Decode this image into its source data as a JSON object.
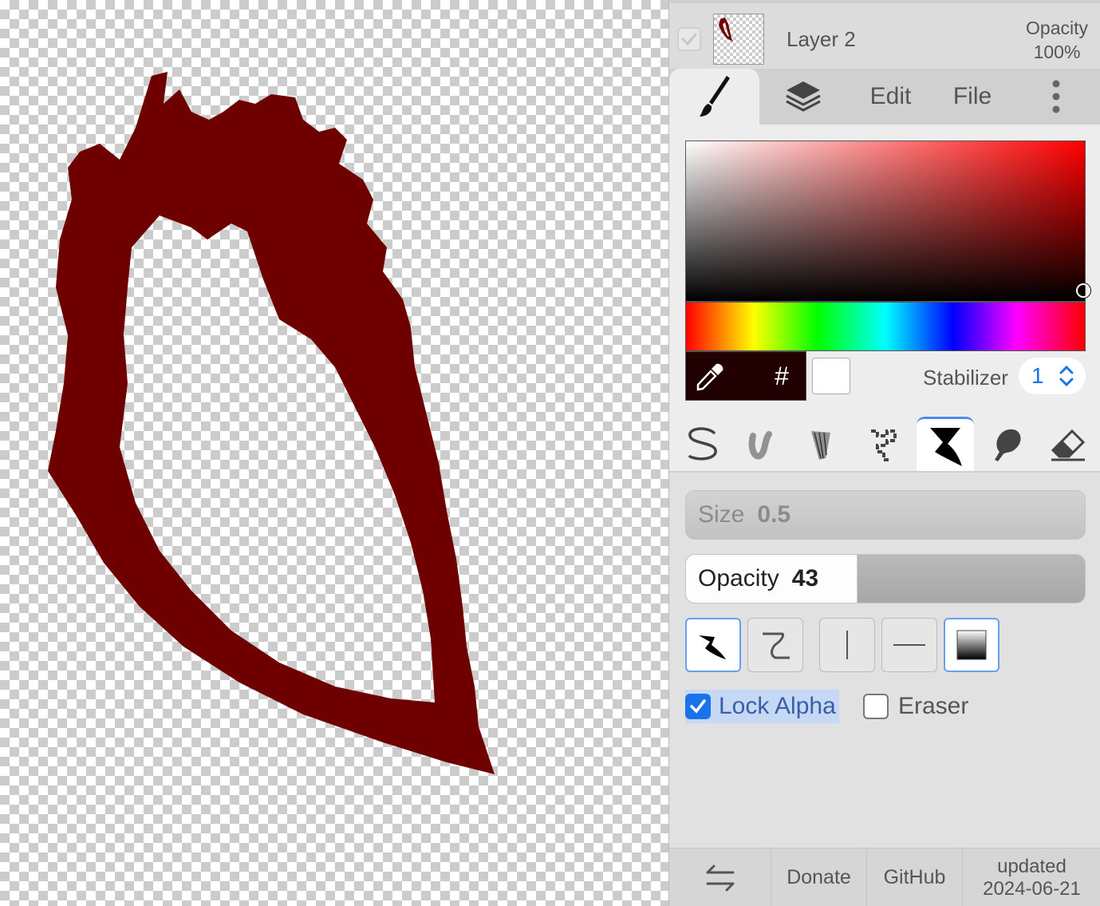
{
  "layer": {
    "name": "Layer 2",
    "opacity_label": "Opacity",
    "opacity_value": "100%",
    "visible": true
  },
  "tabs": {
    "brush_icon": "brush-icon",
    "layers_icon": "layers-icon",
    "edit_label": "Edit",
    "file_label": "File",
    "more_icon": "more-vertical-icon"
  },
  "color": {
    "hue": "#ff0000",
    "current_color": "#200000",
    "secondary_color": "#ffffff",
    "hex_label": "#"
  },
  "stabilizer": {
    "label": "Stabilizer",
    "value": "1"
  },
  "brushes": [
    "pen-brush-icon",
    "blur-brush-icon",
    "texture-brush-icon",
    "pixel-brush-icon",
    "chisel-brush-icon",
    "smudge-brush-icon",
    "eraser-brush-icon"
  ],
  "active_brush": "chisel-brush-icon",
  "size": {
    "label": "Size",
    "value": "0.5"
  },
  "opacity": {
    "label": "Opacity",
    "value": "43",
    "fraction": 0.43
  },
  "modes": [
    "pressure-mode-icon",
    "smooth-stroke-icon",
    "vertical-line-icon",
    "horizontal-line-icon",
    "gradient-icon"
  ],
  "lock_alpha": {
    "label": "Lock Alpha",
    "checked": true
  },
  "eraser": {
    "label": "Eraser",
    "checked": false
  },
  "bottom": {
    "swap_icon": "swap-icon",
    "donate": "Donate",
    "github": "GitHub",
    "updated_label": "updated",
    "updated_date": "2024-06-21"
  },
  "colors": {
    "stroke": "#6e0000",
    "accent": "#1a73e8",
    "panel_bg": "#e1e1e1"
  }
}
